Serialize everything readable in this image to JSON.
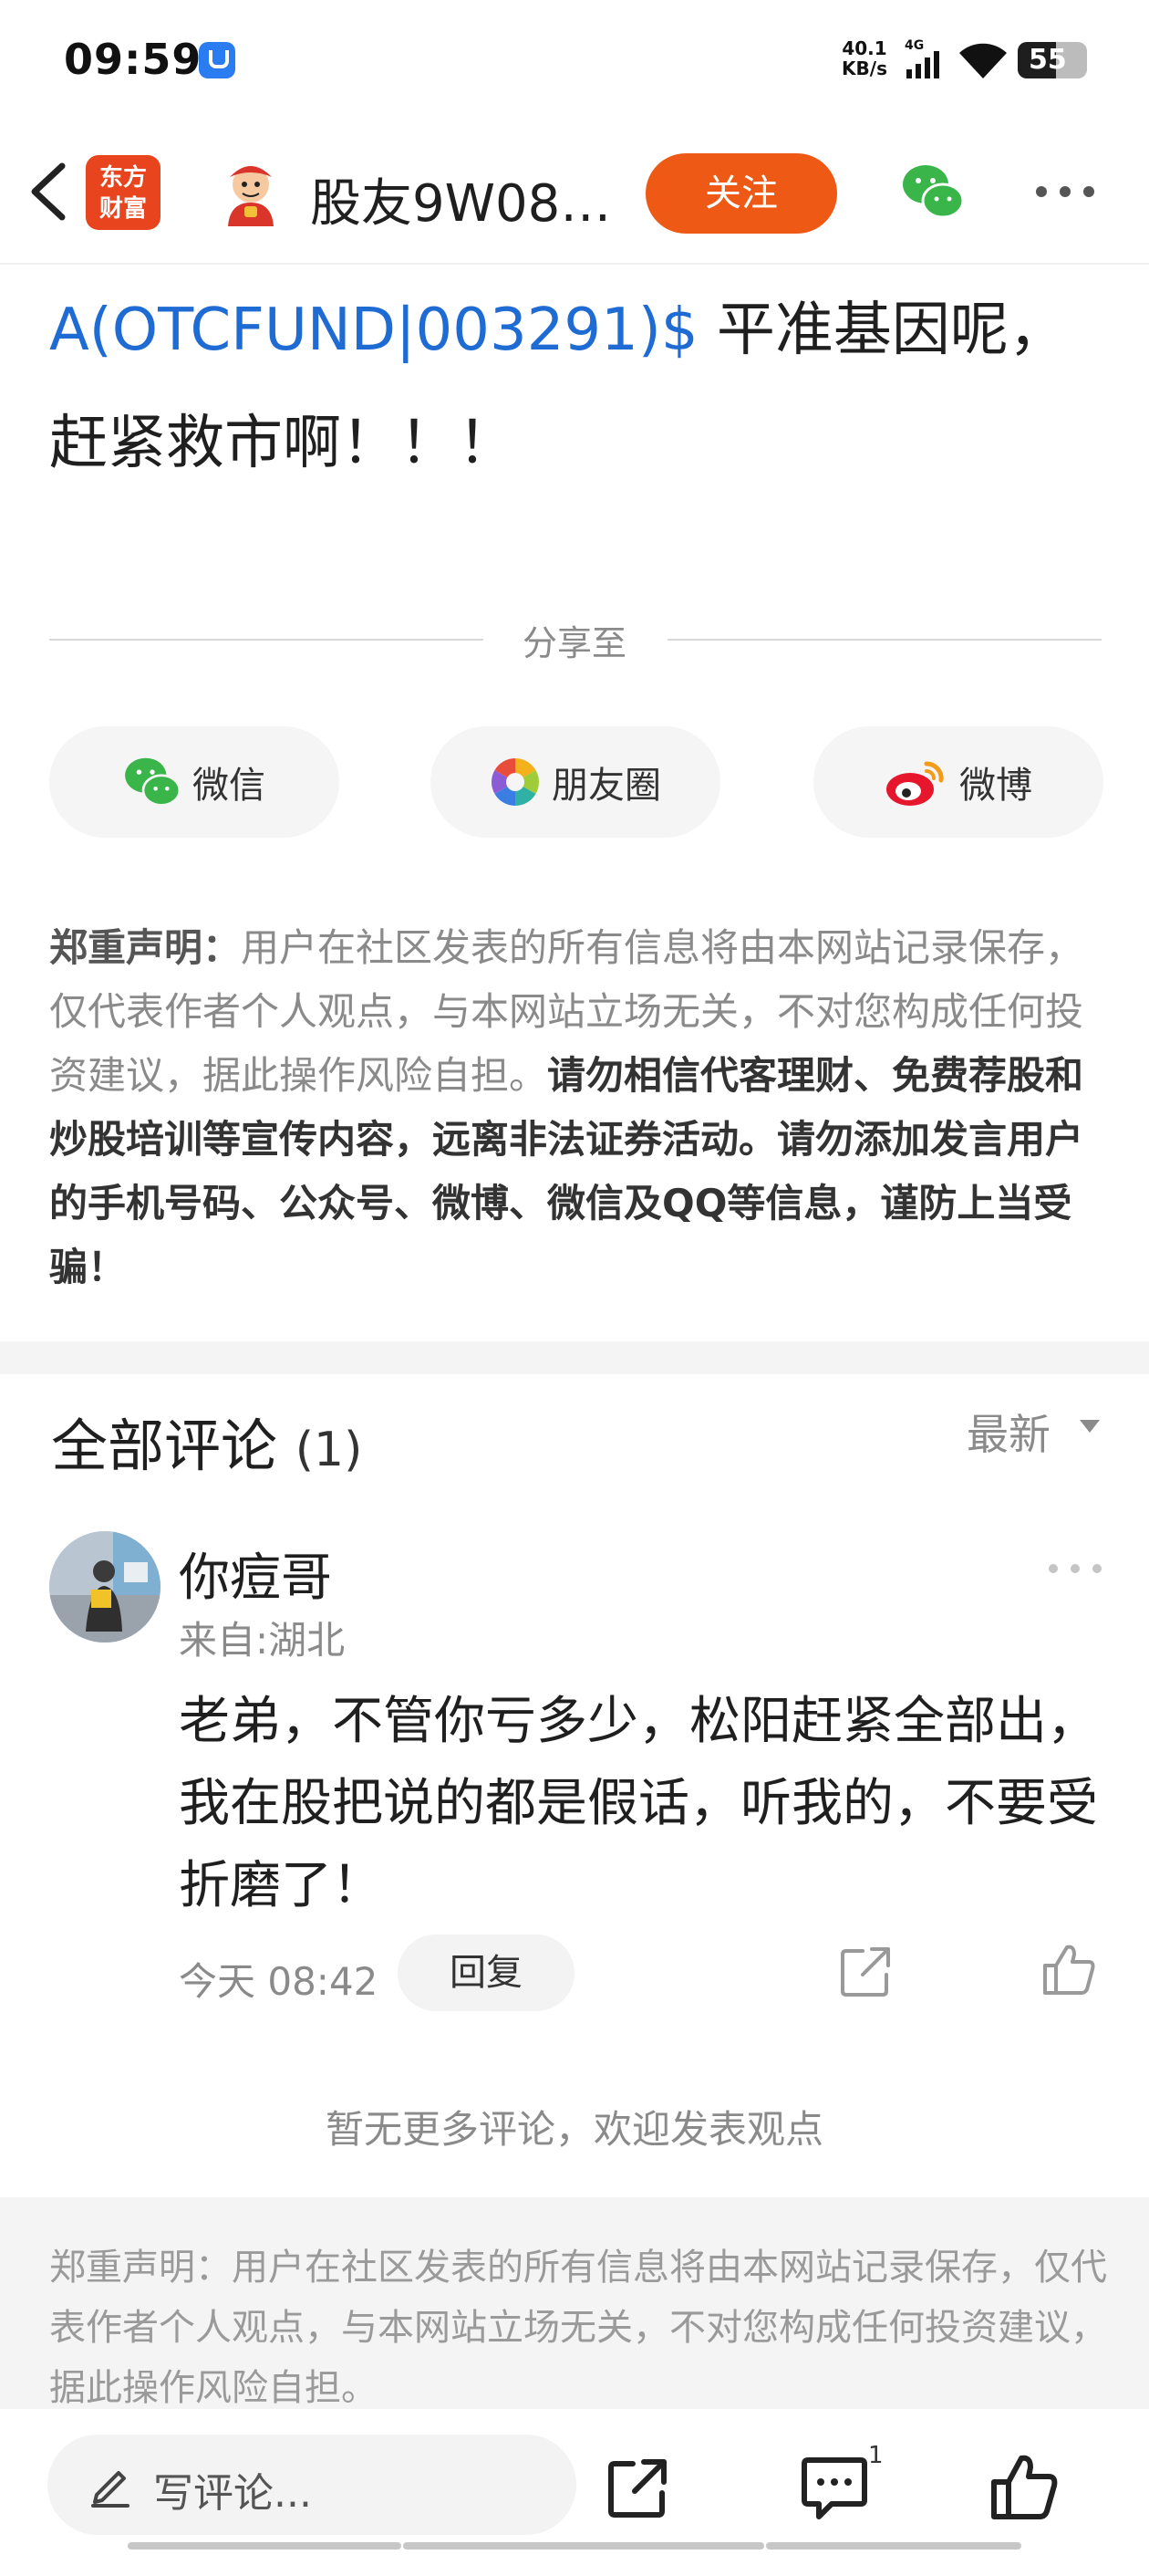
{
  "status_bar": {
    "time": "09:59",
    "net_speed_value": "40.1",
    "net_speed_unit": "KB/s",
    "network": "4G",
    "battery": "55",
    "battery_level": 0.55
  },
  "nav": {
    "logo_line1": "东方",
    "logo_line2": "财富",
    "title": "股友9W08…",
    "follow_label": "关注"
  },
  "article": {
    "fund_link": "A(OTCFUND|003291)$",
    "text": " 平准基因呢，赶紧救市啊！！！"
  },
  "share": {
    "title": "分享至",
    "wechat_label": "微信",
    "moments_label": "朋友圈",
    "weibo_label": "微博"
  },
  "disclaimer": {
    "heading": "郑重声明：",
    "body": "用户在社区发表的所有信息将由本网站记录保存，仅代表作者个人观点，与本网站立场无关，不对您构成任何投资建议，据此操作风险自担。",
    "warning": "请勿相信代客理财、免费荐股和炒股培训等宣传内容，远离非法证券活动。请勿添加发言用户的手机号码、公众号、微博、微信及QQ等信息，谨防上当受骗！"
  },
  "comments": {
    "title": "全部评论",
    "count": "(1)",
    "sort_label": "最新",
    "items": [
      {
        "name": "你痘哥",
        "from": "来自:湖北",
        "body": "老弟，不管你亏多少，松阳赶紧全部出，我在股把说的都是假话，听我的，不要受折磨了！",
        "time": "今天 08:42",
        "reply_label": "回复"
      }
    ],
    "no_more": "暂无更多评论，欢迎发表观点"
  },
  "footer_disclaimer": "郑重声明：用户在社区发表的所有信息将由本网站记录保存，仅代表作者个人观点，与本网站立场无关，不对您构成任何投资建议，据此操作风险自担。",
  "bottom_bar": {
    "input_placeholder": "写评论...",
    "comment_badge": "1"
  },
  "colors": {
    "accent": "#ee5a16",
    "link": "#1f6bd4",
    "muted": "#8a8a8a"
  }
}
